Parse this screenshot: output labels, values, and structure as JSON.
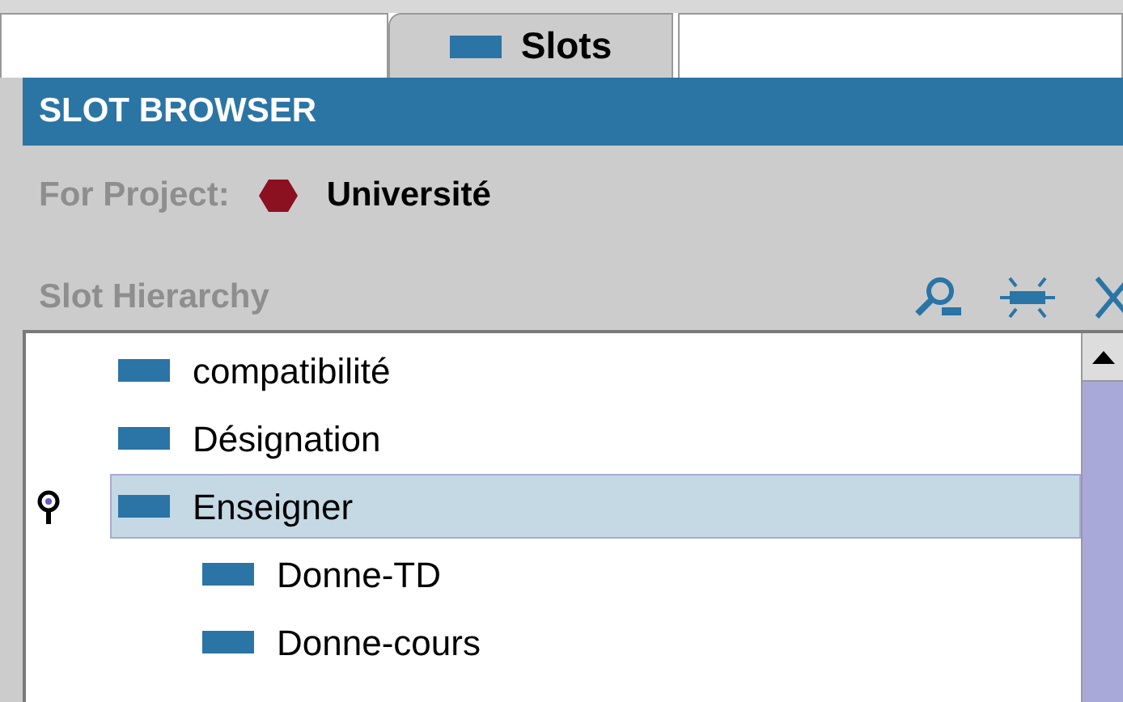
{
  "tabs": [
    {
      "selected": false
    },
    {
      "label": "Slots",
      "selected": true
    },
    {
      "selected": false
    }
  ],
  "header": {
    "title": "SLOT BROWSER"
  },
  "project": {
    "label": "For Project:",
    "name": "Université"
  },
  "hierarchy": {
    "label": "Slot Hierarchy",
    "items": [
      {
        "label": "compatibilité",
        "selected": false,
        "pinned": false
      },
      {
        "label": "Désignation",
        "selected": false,
        "pinned": false
      },
      {
        "label": "Enseigner",
        "selected": true,
        "pinned": true,
        "children": [
          {
            "label": "Donne-TD",
            "selected": false,
            "pinned": false
          },
          {
            "label": "Donne-cours",
            "selected": false,
            "pinned": false
          }
        ]
      }
    ]
  }
}
